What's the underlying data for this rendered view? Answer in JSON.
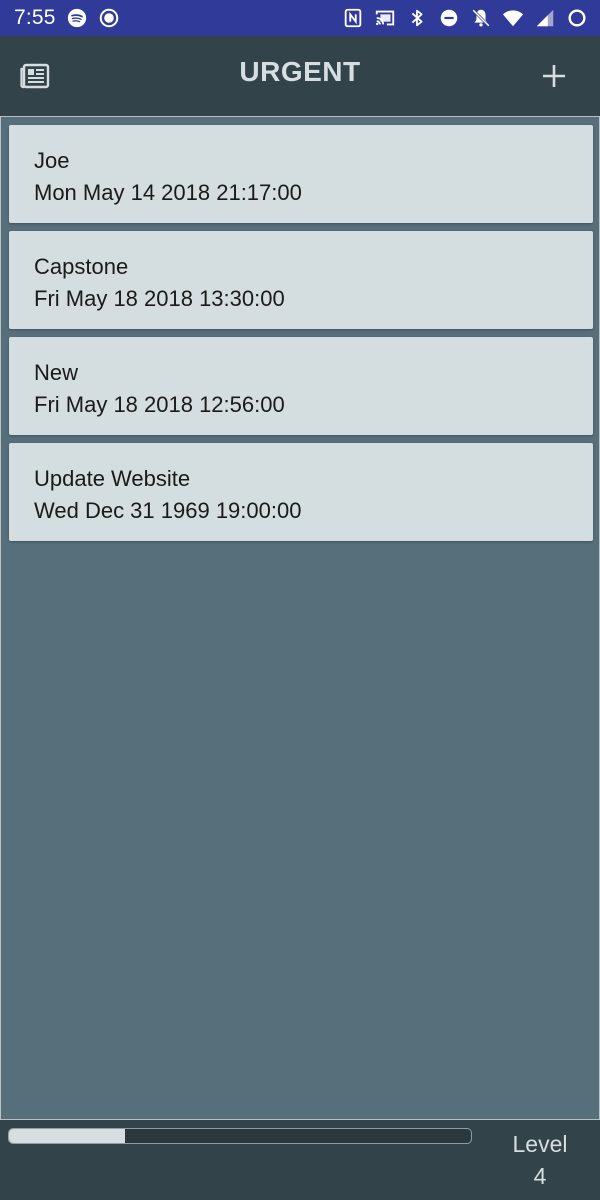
{
  "status_bar": {
    "time": "7:55",
    "left_icons": [
      "spotify-icon",
      "record-icon"
    ],
    "right_icons": [
      "nfc-icon",
      "cast-icon",
      "bluetooth-icon",
      "do-not-disturb-icon",
      "notifications-off-icon",
      "wifi-icon",
      "cellular-signal-icon",
      "battery-icon"
    ],
    "background": "#2f3a99"
  },
  "app_bar": {
    "title": "URGENT",
    "menu_icon": "list-icon",
    "add_icon": "plus-icon"
  },
  "tasks": [
    {
      "name": "Joe",
      "date": "Mon May 14 2018 21:17:00"
    },
    {
      "name": "Capstone",
      "date": "Fri May 18 2018 13:30:00"
    },
    {
      "name": "New",
      "date": "Fri May 18 2018 12:56:00"
    },
    {
      "name": "Update Website",
      "date": "Wed Dec 31 1969 19:00:00"
    }
  ],
  "footer": {
    "progress_fraction": 0.25,
    "level_label": "Level",
    "level_value": "4"
  },
  "colors": {
    "app_bar": "#33434a",
    "content_bg": "#566f7a",
    "card_bg": "#d4dde0",
    "title_text": "#d7dee2"
  }
}
